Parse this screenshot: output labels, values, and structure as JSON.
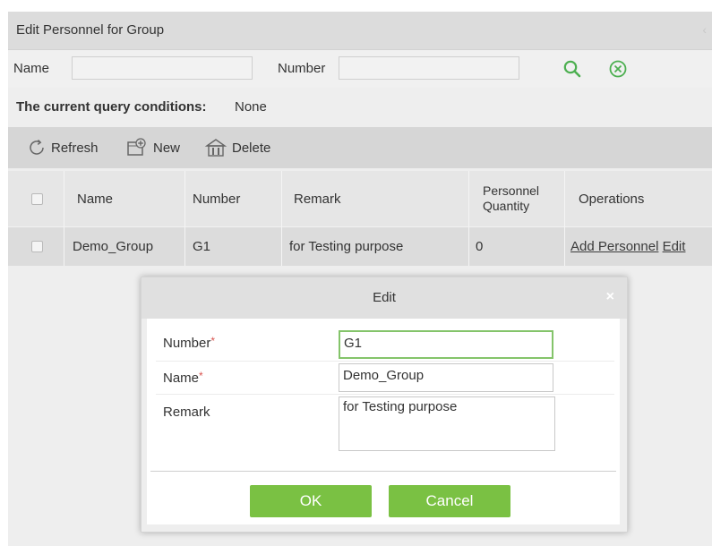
{
  "panel": {
    "title": "Edit Personnel for Group"
  },
  "search": {
    "name_label": "Name",
    "name_value": "",
    "number_label": "Number",
    "number_value": ""
  },
  "query": {
    "label": "The current query conditions:",
    "value": "None"
  },
  "toolbar": {
    "refresh_label": "Refresh",
    "new_label": "New",
    "delete_label": "Delete"
  },
  "table": {
    "headers": [
      "Name",
      "Number",
      "Remark",
      "Personnel Quantity",
      "Operations"
    ],
    "rows": [
      {
        "name": "Demo_Group",
        "number": "G1",
        "remark": "for Testing purpose",
        "quantity": "0",
        "op_add": "Add Personnel",
        "op_edit": "Edit"
      }
    ]
  },
  "dialog": {
    "title": "Edit",
    "close_glyph": "×",
    "number_label": "Number",
    "name_label": "Name",
    "remark_label": "Remark",
    "required_mark": "*",
    "number_value": "G1",
    "name_value": "Demo_Group",
    "remark_value": "for Testing purpose",
    "ok_label": "OK",
    "cancel_label": "Cancel"
  },
  "colors": {
    "accent_green": "#7ac143",
    "focus_green": "#84c46a",
    "required_red": "#d9534f"
  },
  "icons": [
    "refresh-icon",
    "new-icon",
    "delete-icon",
    "search-icon",
    "clear-icon",
    "close-icon",
    "collapse-icon"
  ]
}
